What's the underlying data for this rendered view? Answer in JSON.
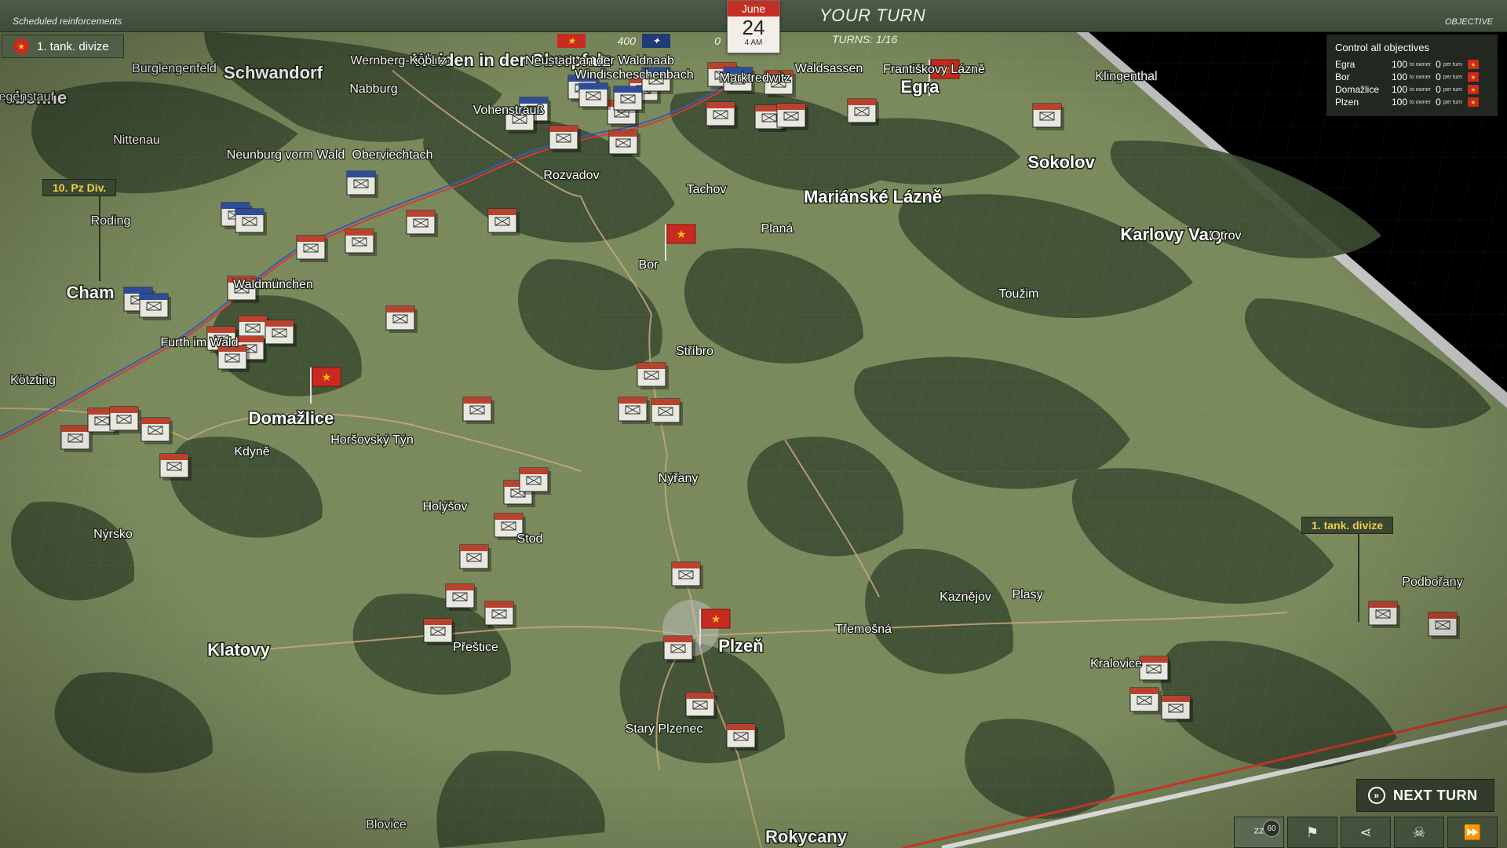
{
  "header": {
    "scheduled_reinforcements": "Scheduled reinforcements",
    "objective_label": "OBJECTIVE",
    "your_turn": "YOUR TURN",
    "turns": "TURNS: 1/16",
    "date": {
      "month": "June",
      "day": "24",
      "time": "4 AM"
    },
    "score_red": "400",
    "score_blue": "0"
  },
  "reinforcement": {
    "label": "1. tank. divize"
  },
  "objectives": {
    "title": "Control all objectives",
    "per_turn_label": "to owner",
    "per_turn_suffix": "per turn",
    "items": [
      {
        "name": "Egra",
        "value": "100",
        "owner": "0"
      },
      {
        "name": "Bor",
        "value": "100",
        "owner": "0"
      },
      {
        "name": "Domažlice",
        "value": "100",
        "owner": "0"
      },
      {
        "name": "Plzen",
        "value": "100",
        "owner": "0"
      }
    ]
  },
  "division_labels": [
    "10. Pz Div.",
    "1. tank. divize"
  ],
  "next_turn": "NEXT TURN",
  "toolbar": {
    "sleep_badge": "60"
  },
  "cities_major": [
    "Schwandorf",
    "Weiden in der Oberpfalz",
    "Egra",
    "Sokolov",
    "Mariánské Lázně",
    "Karlovy Vary",
    "Cham",
    "Domažlice",
    "Klatovy",
    "Plzeň",
    "Rokycany",
    "sbonne"
  ],
  "cities_minor": [
    "Burglengenfeld",
    "Regenstauf",
    "Nabburg",
    "Wernberg-Köblitz",
    "Neustadt an der Waldnaab",
    "Windischeschenbach",
    "Waldsassen",
    "Františkovy Lázně",
    "Klingenthal",
    "Nittenau",
    "Neunburg vorm Wald",
    "Oberviechtach",
    "Vohenstrauß",
    "Rozvadov",
    "Tachov",
    "Planá",
    "Bor",
    "Roding",
    "Waldmünchen",
    "Furth im Wald",
    "Kötzting",
    "Stříbro",
    "Toužim",
    "Kdyně",
    "Horšovský Týn",
    "Nýřany",
    "Holýšov",
    "Stod",
    "Nýrsko",
    "Přeštice",
    "Třemošná",
    "Kaznějov",
    "Plasy",
    "Podbořany",
    "Kralovice",
    "Starý Plzenec",
    "Blovice",
    "Otrov",
    "Marktredwitz"
  ]
}
